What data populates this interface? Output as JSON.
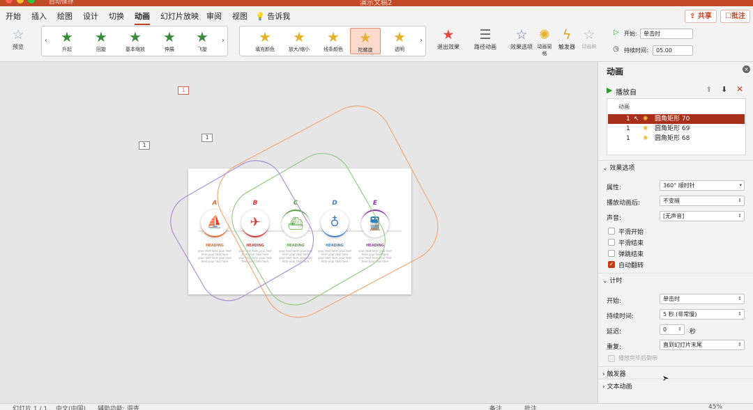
{
  "window": {
    "title": "演示文稿2",
    "autosave": "自动保存"
  },
  "menu": {
    "items": [
      "开始",
      "插入",
      "绘图",
      "设计",
      "切换",
      "动画",
      "幻灯片放映",
      "审阅",
      "视图"
    ],
    "tellme": "告诉我",
    "share": "共享",
    "comments": "批注"
  },
  "ribbon": {
    "preview": "预览",
    "entrance": [
      "升起",
      "回旋",
      "基本缩放",
      "伸展",
      "飞旋"
    ],
    "emphasis": [
      "填充颜色",
      "放大/缩小",
      "线条颜色",
      "陀螺旋",
      "透明"
    ],
    "exit": "退出效果",
    "path": "路径动画",
    "effect_options": "效果选项",
    "anim_pane": "动画窗格",
    "trigger": "触发器",
    "anim_brush": "动画刷",
    "start_label": "开始:",
    "start_value": "单击时",
    "duration_label": "持续时间:",
    "duration_value": "05.00"
  },
  "slide": {
    "tags": [
      "1",
      "1",
      "1"
    ],
    "letters": [
      "A",
      "B",
      "C",
      "D",
      "E"
    ],
    "heading": "HEADING",
    "body": "your text here your text here your text here your text here your text here your text here",
    "colors": [
      "#e26b2c",
      "#d93a3a",
      "#5aa544",
      "#3e7fc8",
      "#8a3aa0"
    ]
  },
  "pane": {
    "title": "动画",
    "play_from": "播放自",
    "list_header": "动画",
    "items": [
      {
        "num": "1",
        "name": "圆角矩形 70"
      },
      {
        "num": "1",
        "name": "圆角矩形 69"
      },
      {
        "num": "1",
        "name": "圆角矩形 68"
      }
    ],
    "effect_section": "效果选项",
    "props": {
      "property_label": "属性:",
      "property_value": "360° 顺时针",
      "after_label": "播放动画后:",
      "after_value": "不变暗",
      "sound_label": "声音:",
      "sound_value": "[无声音]"
    },
    "checks": [
      {
        "label": "平滑开始",
        "on": false
      },
      {
        "label": "平滑结束",
        "on": false
      },
      {
        "label": "弹跳结束",
        "on": false
      },
      {
        "label": "自动翻转",
        "on": true
      }
    ],
    "timing_section": "计时",
    "timing": {
      "start_label": "开始:",
      "start_value": "单击时",
      "duration_label": "持续时间:",
      "duration_value": "5 秒 (非常慢)",
      "delay_label": "延迟:",
      "delay_value": "0",
      "delay_unit": "秒",
      "repeat_label": "重复:",
      "repeat_value": "直到幻灯片末尾",
      "rewind_label": "播放完毕后倒带"
    },
    "trigger_section": "触发器",
    "text_anim_section": "文本动画"
  },
  "status": {
    "slide": "幻灯片 1 / 1",
    "lang": "中文(中国)",
    "access": "辅助功能: 调查",
    "notes": "备注",
    "comments": "批注",
    "zoom": "45%"
  }
}
